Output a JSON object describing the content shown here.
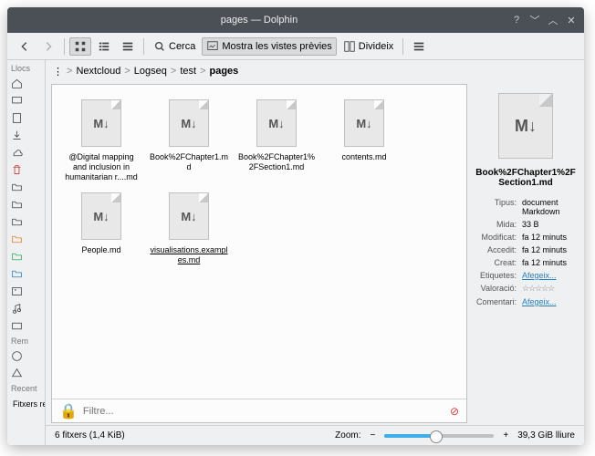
{
  "titlebar": {
    "title": "pages — Dolphin"
  },
  "toolbar": {
    "search": "Cerca",
    "preview": "Mostra les vistes prèvies",
    "split": "Divideix"
  },
  "sidebar": {
    "places": "Llocs",
    "remote": "Rem",
    "recent": "Recent",
    "recent_files": "Fitxers recents"
  },
  "breadcrumb": [
    "Nextcloud",
    "Logseq",
    "test",
    "pages"
  ],
  "files": [
    {
      "name": "@Digital mapping and inclusion in humanitarian r....md"
    },
    {
      "name": "Book%2FChapter1.md"
    },
    {
      "name": "Book%2FChapter1%2FSection1.md"
    },
    {
      "name": "contents.md"
    },
    {
      "name": "People.md"
    },
    {
      "name": "visualisations.examples.md",
      "selected": true
    }
  ],
  "filter": {
    "placeholder": "Filtre..."
  },
  "details": {
    "name": "Book%2FChapter1%2FSection1.md",
    "rows": {
      "type_k": "Tipus:",
      "type_v": "document Markdown",
      "size_k": "Mida:",
      "size_v": "33 B",
      "mod_k": "Modificat:",
      "mod_v": "fa 12 minuts",
      "acc_k": "Accedit:",
      "acc_v": "fa 12 minuts",
      "crt_k": "Creat:",
      "crt_v": "fa 12 minuts",
      "tag_k": "Etiquetes:",
      "tag_v": "Afegeix...",
      "rat_k": "Valoració:",
      "com_k": "Comentari:",
      "com_v": "Afegeix..."
    }
  },
  "status": {
    "count": "6 fitxers (1,4 KiB)",
    "zoom": "Zoom:",
    "free": "39,3 GiB lliure"
  }
}
